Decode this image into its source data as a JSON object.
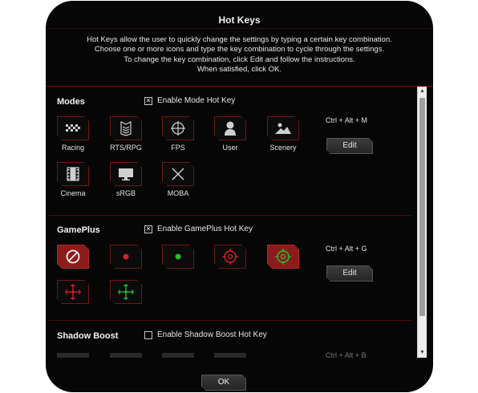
{
  "dialog": {
    "title": "Hot Keys",
    "description": [
      "Hot Keys allow the user to quickly change the settings by typing a certain key combination.",
      "Choose one or more icons and type the key combination to cycle through the settings.",
      "To change the key combination, click Edit and follow the instructions.",
      "When satisfied, click OK."
    ],
    "ok_label": "OK"
  },
  "modes": {
    "title": "Modes",
    "enable_label": "Enable Mode Hot Key",
    "enable_checked": true,
    "hotkey": "Ctrl + Alt + M",
    "edit_label": "Edit",
    "items": [
      {
        "label": "Racing",
        "icon": "racing-flag-icon"
      },
      {
        "label": "RTS/RPG",
        "icon": "rank-chevron-icon"
      },
      {
        "label": "FPS",
        "icon": "crosshair-icon"
      },
      {
        "label": "User",
        "icon": "user-icon"
      },
      {
        "label": "Scenery",
        "icon": "landscape-icon"
      },
      {
        "label": "Cinema",
        "icon": "film-icon"
      },
      {
        "label": "sRGB",
        "icon": "monitor-icon"
      },
      {
        "label": "MOBA",
        "icon": "crossed-swords-icon"
      }
    ]
  },
  "gameplus": {
    "title": "GamePlus",
    "enable_label": "Enable GamePlus Hot Key",
    "enable_checked": true,
    "hotkey": "Ctrl + Alt + G",
    "edit_label": "Edit",
    "items": [
      {
        "icon": "none-icon",
        "active": true
      },
      {
        "icon": "red-dot-icon"
      },
      {
        "icon": "green-dot-icon"
      },
      {
        "icon": "red-circle-crosshair-icon"
      },
      {
        "icon": "green-circle-crosshair-icon",
        "active": true
      },
      {
        "icon": "red-cross-crosshair-icon"
      },
      {
        "icon": "green-cross-crosshair-icon"
      }
    ]
  },
  "shadow_boost": {
    "title": "Shadow Boost",
    "enable_label": "Enable Shadow Boost Hot Key",
    "enable_checked": false,
    "hotkey": "Ctrl + Alt + B"
  },
  "colors": {
    "background": "#060606",
    "accent": "#8a1c1c",
    "tile_border": "#6e1616",
    "red_icon": "#e02020",
    "green_icon": "#22c42a"
  }
}
